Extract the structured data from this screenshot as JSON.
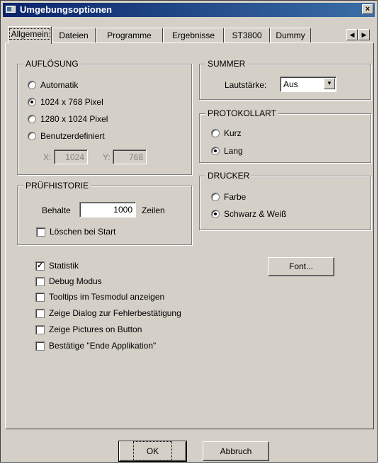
{
  "window": {
    "title": "Umgebungsoptionen",
    "close_label": "×"
  },
  "tabs": [
    "Allgemein",
    "Dateien",
    "Programme",
    "Ergebnisse",
    "ST3800",
    "Dummy"
  ],
  "tab_scroll": {
    "left": "◀",
    "right": "▶"
  },
  "aufloesung": {
    "legend": "AUFLÖSUNG",
    "options": [
      "Automatik",
      "1024 x 768 Pixel",
      "1280 x 1024 Pixel",
      "Benutzerdefiniert"
    ],
    "selected": "1024 x 768 Pixel",
    "x_label": "X:",
    "x_value": "1024",
    "y_label": "Y:",
    "y_value": "768"
  },
  "pruefhistorie": {
    "legend": "PRÜFHISTORIE",
    "keep_label": "Behalte",
    "keep_value": "1000",
    "keep_unit": "Zeilen",
    "delete_label": "Löschen bei Start",
    "delete_checked": false
  },
  "summer": {
    "legend": "SUMMER",
    "volume_label": "Lautstärke:",
    "volume_value": "Aus"
  },
  "protokollart": {
    "legend": "PROTOKOLLART",
    "options": [
      "Kurz",
      "Lang"
    ],
    "selected": "Lang"
  },
  "drucker": {
    "legend": "DRUCKER",
    "options": [
      "Farbe",
      "Schwarz & Weiß"
    ],
    "selected": "Schwarz & Weiß"
  },
  "checkboxes": [
    {
      "label": "Statistik",
      "checked": true
    },
    {
      "label": "Debug Modus",
      "checked": false
    },
    {
      "label": "Tooltips im Tesmodul anzeigen",
      "checked": false
    },
    {
      "label": "Zeige Dialog zur Fehlerbestätigung",
      "checked": false
    },
    {
      "label": "Zeige Pictures on Button",
      "checked": false
    },
    {
      "label": "Bestätige \"Ende Applikation\"",
      "checked": false
    }
  ],
  "font_button": "Font...",
  "ok_button": "OK",
  "cancel_button": "Abbruch",
  "check_mark": "✓"
}
